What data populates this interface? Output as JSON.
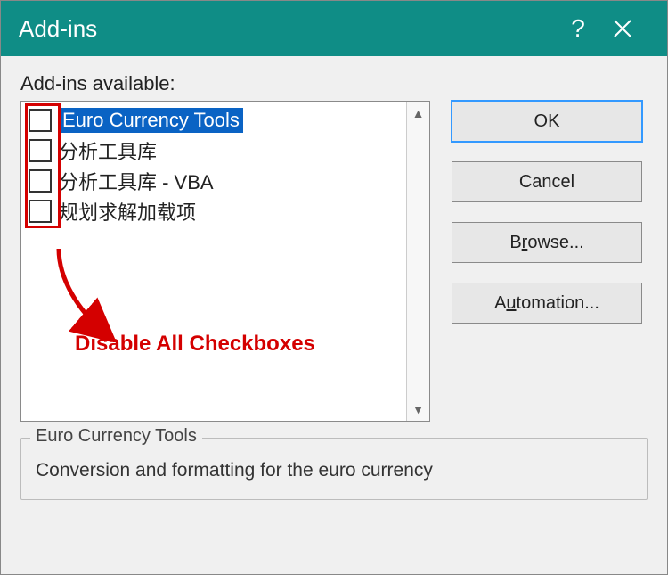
{
  "dialog": {
    "title": "Add-ins",
    "help_symbol": "?",
    "available_label": "Add-ins available:"
  },
  "addins": [
    {
      "label": "Euro Currency Tools",
      "checked": false,
      "selected": true
    },
    {
      "label": "分析工具库",
      "checked": false,
      "selected": false
    },
    {
      "label": "分析工具库 - VBA",
      "checked": false,
      "selected": false
    },
    {
      "label": "规划求解加载项",
      "checked": false,
      "selected": false
    }
  ],
  "buttons": {
    "ok": "OK",
    "cancel": "Cancel",
    "browse_pre": "B",
    "browse_u": "r",
    "browse_post": "owse...",
    "auto_pre": "A",
    "auto_u": "u",
    "auto_post": "tomation..."
  },
  "description": {
    "title": "Euro Currency Tools",
    "body": "Conversion and formatting for the euro currency"
  },
  "annotation": {
    "text": "Disable All Checkboxes"
  }
}
